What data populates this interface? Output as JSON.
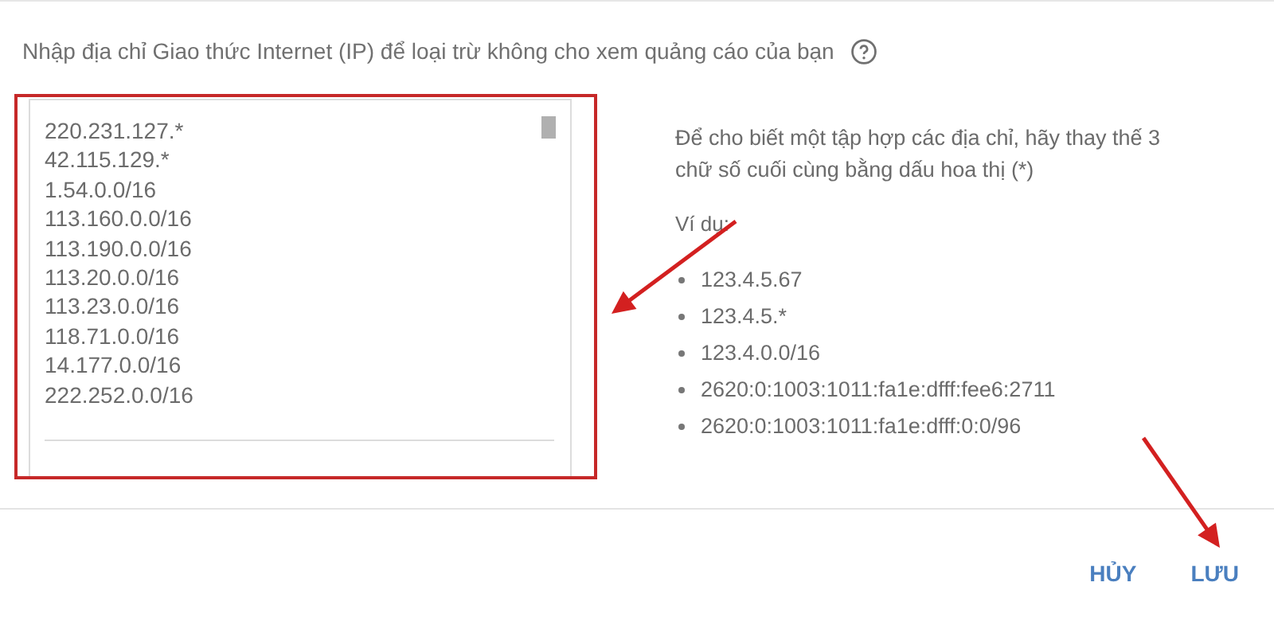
{
  "prompt": {
    "label": "Nhập địa chỉ Giao thức Internet (IP) để loại trừ không cho xem quảng cáo của bạn"
  },
  "ip_list": {
    "lines": [
      "220.231.127.*",
      "42.115.129.*",
      "1.54.0.0/16",
      "113.160.0.0/16",
      "113.190.0.0/16",
      "113.20.0.0/16",
      "113.23.0.0/16",
      "118.71.0.0/16",
      "14.177.0.0/16",
      "222.252.0.0/16"
    ]
  },
  "hint": "Để cho biết một tập hợp các địa chỉ, hãy thay thế 3 chữ số cuối cùng bằng dấu hoa thị (*)",
  "examples_label": "Ví dụ:",
  "examples": [
    "123.4.5.67",
    "123.4.5.*",
    "123.4.0.0/16",
    "2620:0:1003:1011:fa1e:dfff:fee6:2711",
    "2620:0:1003:1011:fa1e:dfff:0:0/96"
  ],
  "buttons": [
    {
      "label": "HỦY"
    },
    {
      "label": "LƯU"
    }
  ]
}
